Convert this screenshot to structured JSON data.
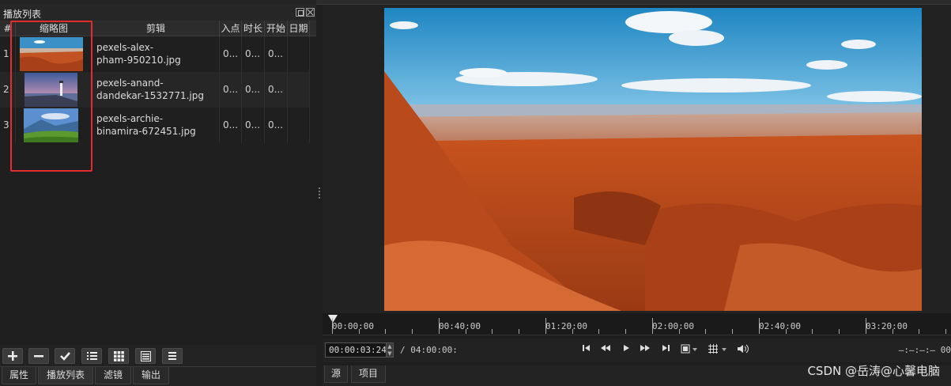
{
  "playlist": {
    "title": "播放列表",
    "columns": [
      "#",
      "缩略图",
      "剪辑",
      "入点",
      "时长",
      "开始",
      "日期"
    ],
    "rows": [
      {
        "index": "1",
        "clip_line1": "pexels-alex-",
        "clip_line2": "pham-950210.jpg",
        "in": "0...",
        "duration": "0...",
        "start": "0..."
      },
      {
        "index": "2",
        "clip_line1": "pexels-anand-",
        "clip_line2": "dandekar-1532771.jpg",
        "in": "0...",
        "duration": "0...",
        "start": "0..."
      },
      {
        "index": "3",
        "clip_line1": "pexels-archie-",
        "clip_line2": "binamira-672451.jpg",
        "in": "0...",
        "duration": "0...",
        "start": "0..."
      }
    ],
    "toolbar_icons": [
      "plus-icon",
      "minus-icon",
      "check-icon",
      "list-details-icon",
      "grid-icon",
      "table-icon",
      "menu-icon"
    ],
    "tabs": [
      "属性",
      "播放列表",
      "滤镜",
      "输出"
    ],
    "active_tab": "播放列表"
  },
  "timeline": {
    "ticks": [
      "00:00:00",
      "00:40:00",
      "01:20:00",
      "02:00:00",
      "02:40:00",
      "03:20:00"
    ]
  },
  "transport": {
    "current_time": "00:00:03:24",
    "total_time": "/ 04:00:00:",
    "remaining": "—:—:—:— 00"
  },
  "viewer_tabs": [
    "源",
    "项目"
  ],
  "watermark": "CSDN @岳涛@心馨电脑",
  "colors": {
    "highlight_box": "#e32d2d",
    "panel_bg": "#232323",
    "sky": "#2e8fc4",
    "rock": "#c4521f"
  }
}
